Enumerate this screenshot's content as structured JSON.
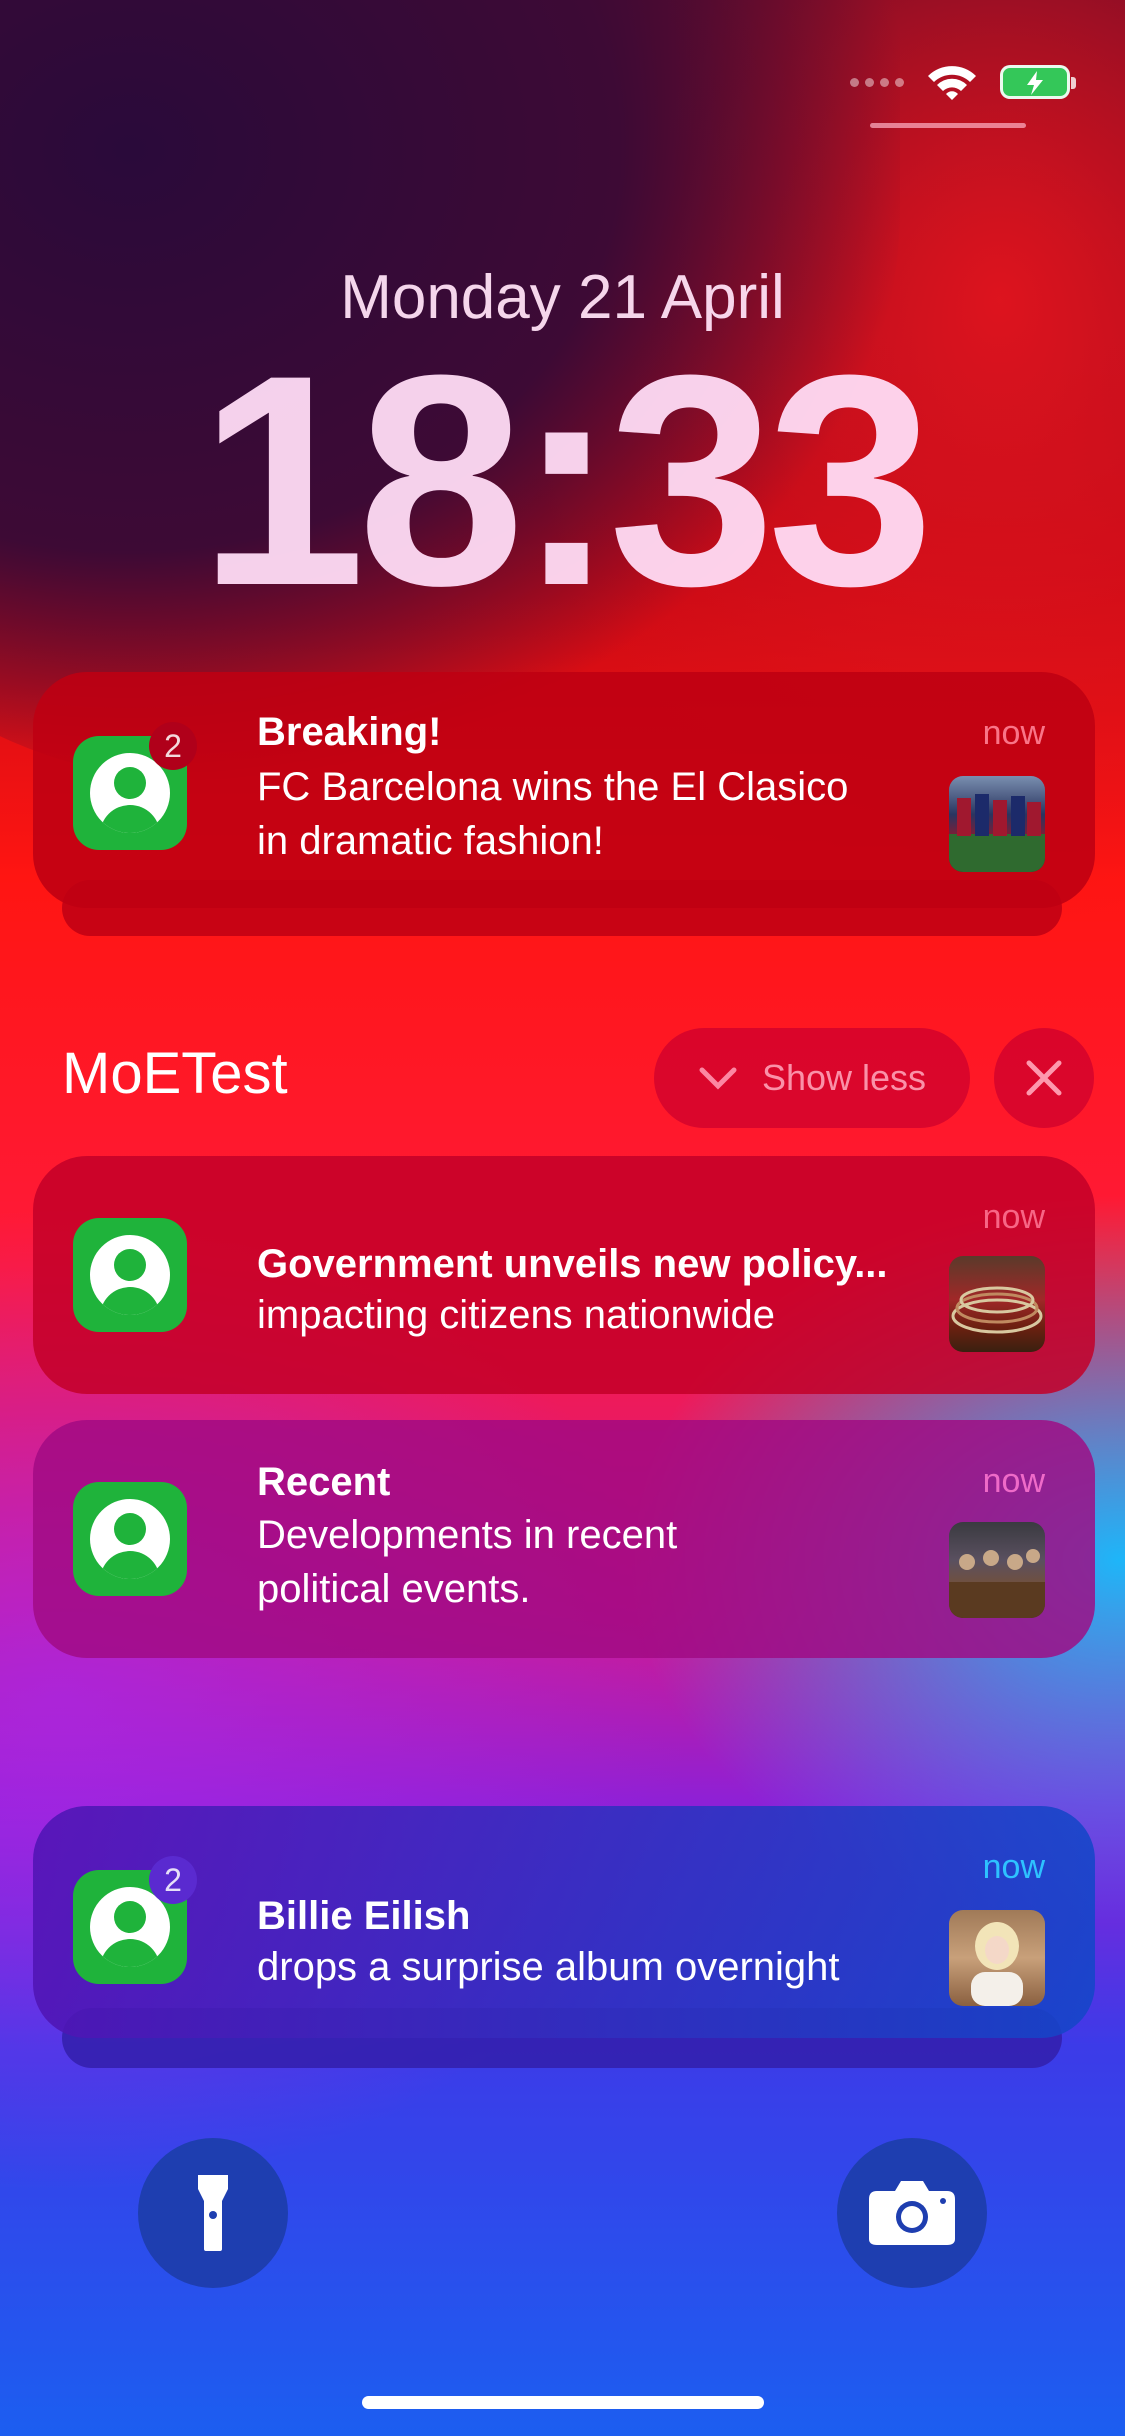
{
  "status_bar": {
    "wifi_icon": "wifi-icon",
    "battery_icon": "battery-charging-icon",
    "battery_color": "#34c759"
  },
  "lock": {
    "date": "Monday 21 April",
    "time": "18:33"
  },
  "notifications": [
    {
      "title": "Breaking!",
      "body_line1": "FC Barcelona wins the El Clasico",
      "body_line2": "in dramatic fashion!",
      "time": "now",
      "badge": "2"
    }
  ],
  "group": {
    "app_name": "MoETest",
    "show_less_label": "Show less",
    "items": [
      {
        "title": "Government unveils new policy...",
        "body_line1": "impacting citizens nationwide",
        "time": "now"
      },
      {
        "title": "Recent",
        "body_line1": "Developments in recent",
        "body_line2": "political events.",
        "time": "now"
      }
    ]
  },
  "bottom_notification": {
    "title": "Billie Eilish",
    "body_line1": "drops a surprise album overnight",
    "time": "now",
    "badge": "2"
  },
  "quick_actions": {
    "flashlight_icon": "flashlight-icon",
    "camera_icon": "camera-icon"
  }
}
